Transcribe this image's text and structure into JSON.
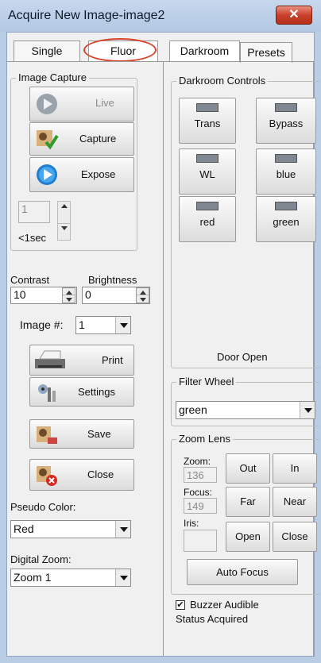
{
  "window": {
    "title": "Acquire New Image-image2",
    "close_symbol": "✕"
  },
  "tabs_left": [
    {
      "label": "Single"
    },
    {
      "label": "Fluor"
    }
  ],
  "tabs_right": [
    {
      "label": "Darkroom"
    },
    {
      "label": "Presets"
    }
  ],
  "image_capture": {
    "title": "Image Capture",
    "live_label": "Live",
    "capture_label": "Capture",
    "expose_label": "Expose",
    "exposure_value": "1",
    "exposure_unit": "<1sec"
  },
  "adjust": {
    "contrast_label": "Contrast",
    "brightness_label": "Brightness",
    "contrast_value": "10",
    "brightness_value": "0",
    "image_num_label": "Image #:",
    "image_num_value": "1"
  },
  "actions": {
    "print_label": "Print",
    "settings_label": "Settings",
    "save_label": "Save",
    "close_label": "Close"
  },
  "pseudo_color": {
    "label": "Pseudo Color:",
    "value": "Red"
  },
  "digital_zoom": {
    "label": "Digital Zoom:",
    "value": "Zoom 1"
  },
  "darkroom": {
    "title": "Darkroom Controls",
    "buttons": [
      {
        "label": "Trans"
      },
      {
        "label": "Bypass"
      },
      {
        "label": "WL"
      },
      {
        "label": "blue"
      },
      {
        "label": "red"
      },
      {
        "label": "green"
      }
    ],
    "door_status": "Door Open"
  },
  "filter_wheel": {
    "title": "Filter Wheel",
    "value": "green"
  },
  "zoom_lens": {
    "title": "Zoom Lens",
    "zoom_label": "Zoom:",
    "zoom_value": "136",
    "focus_label": "Focus:",
    "focus_value": "149",
    "iris_label": "Iris:",
    "iris_value": "",
    "out_label": "Out",
    "in_label": "In",
    "far_label": "Far",
    "near_label": "Near",
    "open_label": "Open",
    "close_label": "Close",
    "auto_focus_label": "Auto Focus"
  },
  "buzzer": {
    "label": "Buzzer Audible",
    "checked": true
  },
  "status": "Status Acquired",
  "colors": {
    "highlight_ellipse": "#d9432c",
    "window_frame": "#b9cde5",
    "close_red": "#c9412a"
  }
}
